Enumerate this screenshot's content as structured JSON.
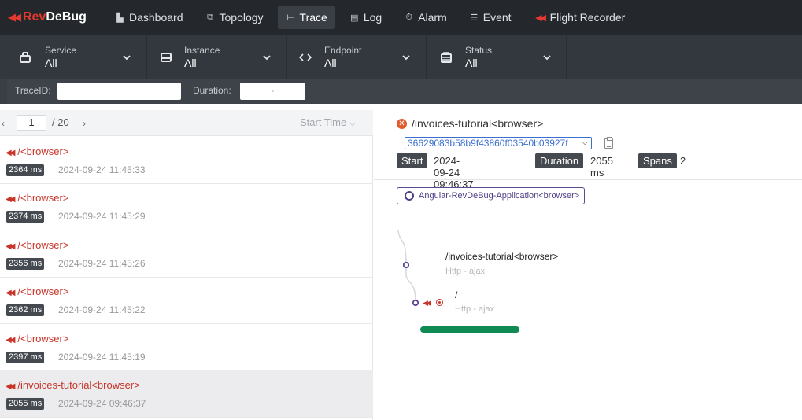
{
  "app": {
    "logo_prefix": "Rev",
    "logo_suffix": "DeBug"
  },
  "nav": [
    {
      "label": "Dashboard",
      "icon": "chart-icon"
    },
    {
      "label": "Topology",
      "icon": "topology-icon"
    },
    {
      "label": "Trace",
      "icon": "trace-icon",
      "active": true
    },
    {
      "label": "Log",
      "icon": "log-icon"
    },
    {
      "label": "Alarm",
      "icon": "alarm-icon"
    },
    {
      "label": "Event",
      "icon": "event-icon"
    },
    {
      "label": "Flight Recorder",
      "icon": "flight-recorder-icon"
    }
  ],
  "filters": {
    "service": {
      "label": "Service",
      "value": "All"
    },
    "instance": {
      "label": "Instance",
      "value": "All"
    },
    "endpoint": {
      "label": "Endpoint",
      "value": "All"
    },
    "status": {
      "label": "Status",
      "value": "All"
    }
  },
  "search": {
    "traceid_label": "TraceID:",
    "traceid_value": "",
    "duration_label": "Duration:",
    "duration_separator": "-"
  },
  "pager": {
    "current_page": "1",
    "total": "/ 20",
    "sort_label": "Start Time"
  },
  "traces": [
    {
      "name": "/<browser>",
      "duration": "2364 ms",
      "time": "2024-09-24 11:45:33"
    },
    {
      "name": "/<browser>",
      "duration": "2374 ms",
      "time": "2024-09-24 11:45:29"
    },
    {
      "name": "/<browser>",
      "duration": "2356 ms",
      "time": "2024-09-24 11:45:26"
    },
    {
      "name": "/<browser>",
      "duration": "2362 ms",
      "time": "2024-09-24 11:45:22"
    },
    {
      "name": "/<browser>",
      "duration": "2397 ms",
      "time": "2024-09-24 11:45:19"
    },
    {
      "name": "/invoices-tutorial<browser>",
      "duration": "2055 ms",
      "time": "2024-09-24 09:46:37",
      "selected": true
    }
  ],
  "detail": {
    "title": "/invoices-tutorial<browser>",
    "trace_id": "36629083b58b9f43860f03540b03927f",
    "start_label": "Start",
    "start_value": "2024-09-24 09:46:37",
    "duration_label": "Duration",
    "duration_value": "2055 ms",
    "spans_label": "Spans",
    "spans_value": "2",
    "service_tag": "Angular-RevDeBug-Application<browser>",
    "spans": [
      {
        "name": "/invoices-tutorial<browser>",
        "type": "Http - ajax"
      },
      {
        "name": "/",
        "type": "Http - ajax"
      }
    ]
  },
  "colors": {
    "accent_red": "#e5382f",
    "nav_bg": "#24272c",
    "filter_bg": "#33373e",
    "span_bar": "#0f8a52",
    "service_purple": "#4f3f86"
  }
}
